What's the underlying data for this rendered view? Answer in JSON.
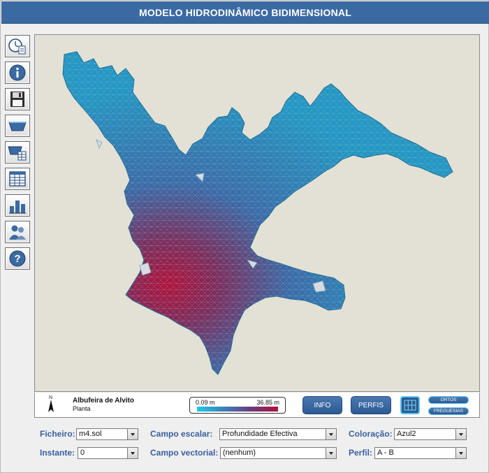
{
  "window": {
    "title": "MODELO HIDRODINÂMICO BIDIMENSIONAL"
  },
  "toolbar": {
    "tools": [
      {
        "icon": "clock-document-icon"
      },
      {
        "icon": "info-icon"
      },
      {
        "icon": "save-disk-icon"
      },
      {
        "icon": "cross-section-icon"
      },
      {
        "icon": "profile-table-icon"
      },
      {
        "icon": "spreadsheet-icon"
      },
      {
        "icon": "bar-chart-icon"
      },
      {
        "icon": "users-icon"
      },
      {
        "icon": "help-icon"
      }
    ]
  },
  "map": {
    "north_label": "N",
    "site_name": "Albufeira de Alvito",
    "site_view": "Planta",
    "scale_min": "0.09 m",
    "scale_max": "36.85 m",
    "colors": {
      "shallow": "#1ec9e6",
      "mid": "#3c7fb8",
      "deep": "#b2123a",
      "land": "#e3e1d5"
    }
  },
  "buttons": {
    "info": "INFO",
    "perfis": "PERFIS",
    "ortos": "ORTOS",
    "freguesias": "FREGUESIAS"
  },
  "controls": {
    "ficheiro": {
      "label": "Ficheiro:",
      "value": "m4.sol"
    },
    "instante": {
      "label": "Instante:",
      "value": "0"
    },
    "campo_escalar": {
      "label": "Campo escalar:",
      "value": "Profundidade Efectiva"
    },
    "campo_vectorial": {
      "label": "Campo vectorial:",
      "value": "(nenhum)"
    },
    "coloracao": {
      "label": "Coloração:",
      "value": "Azul2"
    },
    "perfil": {
      "label": "Perfil:",
      "value": "A - B"
    }
  }
}
